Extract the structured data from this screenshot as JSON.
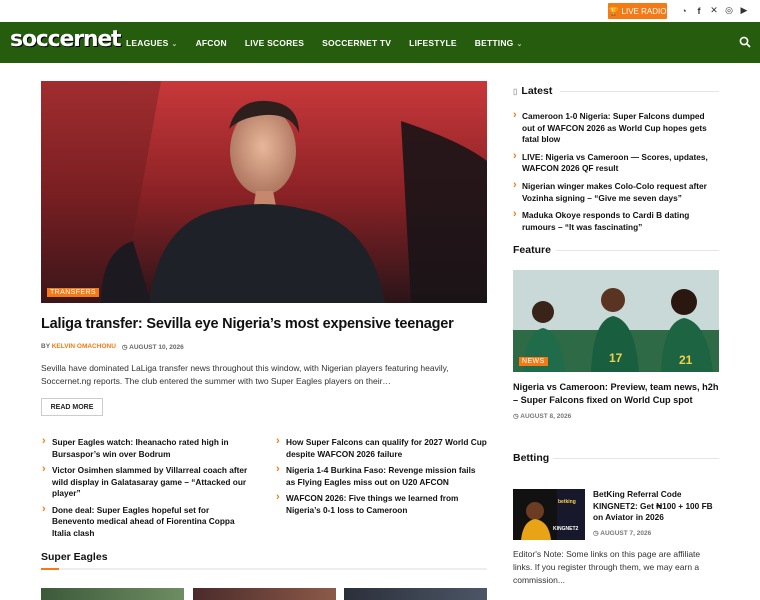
{
  "topbar": {
    "live_radio": "LIVE RADIO",
    "socials": [
      "whatsapp-icon",
      "facebook-icon",
      "x-icon",
      "instagram-icon",
      "youtube-icon"
    ]
  },
  "nav": {
    "logo": "soccernet",
    "items": [
      {
        "label": "LEAGUES",
        "dropdown": true
      },
      {
        "label": "AFCON",
        "dropdown": false
      },
      {
        "label": "LIVE SCORES",
        "dropdown": false
      },
      {
        "label": "SOCCERNET TV",
        "dropdown": false
      },
      {
        "label": "LIFESTYLE",
        "dropdown": false
      },
      {
        "label": "BETTING",
        "dropdown": true
      }
    ]
  },
  "hero": {
    "tag": "TRANSFERS",
    "title": "Laliga transfer: Sevilla eye Nigeria’s most expensive teenager",
    "by": "BY",
    "author": "KELVIN OMACHONU",
    "date": "AUGUST 10, 2026",
    "excerpt": "Sevilla have dominated LaLiga transfer news throughout this window, with Nigerian players featuring heavily, Soccernet.ng reports. The club entered the summer with two Super Eagles players on their…",
    "read_more": "READ MORE"
  },
  "more_left": [
    "Super Eagles watch: Iheanacho rated high in Bursaspor’s win over Bodrum",
    "Victor Osimhen slammed by Villarreal coach after wild display in Galatasaray game – “Attacked our player”",
    "Done deal: Super Eagles hopeful set for Benevento medical ahead of Fiorentina Coppa Italia clash"
  ],
  "more_right": [
    "How Super Falcons can qualify for 2027 World Cup despite WAFCON 2026 failure",
    "Nigeria 1-4 Burkina Faso: Revenge mission fails as Flying Eagles miss out on U20 AFCON",
    "WAFCON 2026: Five things we learned from Nigeria’s 0-1 loss to Cameroon"
  ],
  "super_eagles": {
    "heading": "Super Eagles"
  },
  "sidebar": {
    "latest_heading": "Latest",
    "latest": [
      "Cameroon 1-0 Nigeria: Super Falcons dumped out of WAFCON 2026 as World Cup hopes gets fatal blow",
      "LIVE: Nigeria vs Cameroon — Scores, updates, WAFCON 2026 QF result",
      "Nigerian winger makes Colo-Colo request after Vozinha signing – “Give me seven days”",
      "Maduka Okoye responds to Cardi B dating rumours – “It was fascinating”"
    ],
    "feature_heading": "Feature",
    "feature": {
      "tag": "NEWS",
      "title": "Nigeria vs Cameroon: Preview, team news, h2h – Super Falcons fixed on World Cup spot",
      "date": "AUGUST 8, 2026"
    },
    "betting_heading": "Betting",
    "betting": {
      "brand": "betking",
      "img_text": "KINGNET2",
      "title": "BetKing Referral Code KINGNET2: Get ₦100 + 100 FB on Aviator in 2026",
      "date": "AUGUST 7, 2026"
    },
    "editor_note": "Editor's Note: Some links on this page are affiliate links. If you register through them, we may earn a commission..."
  },
  "colors": {
    "accent": "#f37a14",
    "nav": "#265c0e"
  }
}
